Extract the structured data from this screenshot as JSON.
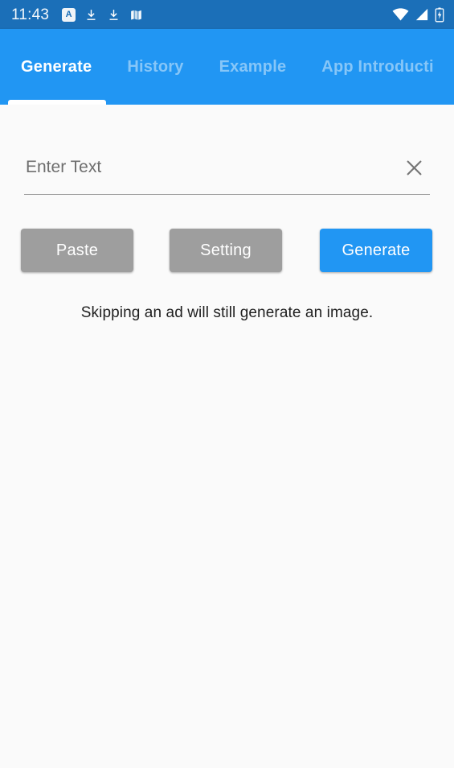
{
  "status_bar": {
    "time": "11:43",
    "left_icons": [
      {
        "name": "app-letter-badge-icon",
        "glyph": "A"
      },
      {
        "name": "download-icon",
        "glyph": "download"
      },
      {
        "name": "download-icon-2",
        "glyph": "download"
      },
      {
        "name": "map-icon",
        "glyph": "map"
      }
    ],
    "right_icons": [
      {
        "name": "wifi-icon"
      },
      {
        "name": "cellular-signal-icon"
      },
      {
        "name": "battery-charging-icon"
      }
    ],
    "background_color": "#1b6fb8"
  },
  "tabs": {
    "active_index": 0,
    "accent_color": "#2196f3",
    "items": [
      {
        "label": "Generate"
      },
      {
        "label": "History"
      },
      {
        "label": "Example"
      },
      {
        "label": "App Introducti"
      }
    ]
  },
  "form": {
    "text_field": {
      "value": "",
      "placeholder": "Enter Text"
    },
    "clear_icon": "close-icon"
  },
  "buttons": {
    "paste_label": "Paste",
    "setting_label": "Setting",
    "generate_label": "Generate",
    "grey_color": "#9e9e9e",
    "blue_color": "#2196f3"
  },
  "hint": {
    "text": "Skipping an ad will still generate an image."
  },
  "page": {
    "background_color": "#fafafa"
  }
}
